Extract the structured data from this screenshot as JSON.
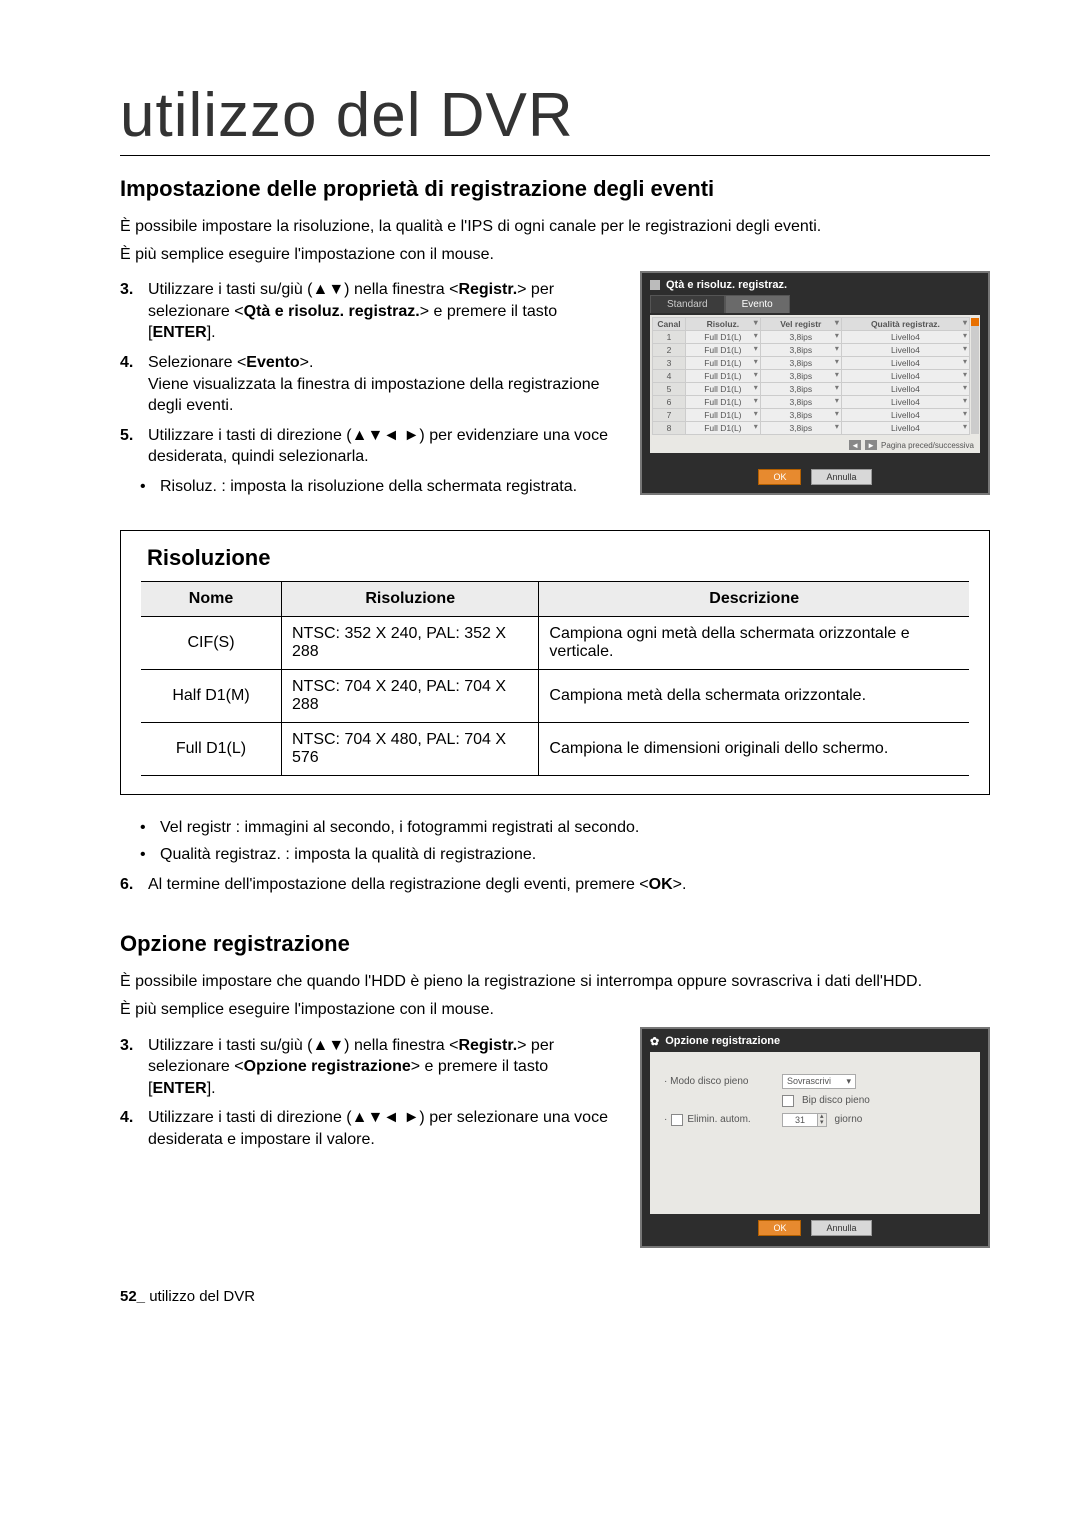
{
  "page_title": "utilizzo del DVR",
  "h2_1": "Impostazione delle proprietà di registrazione degli eventi",
  "intro_1": "È possibile impostare la risoluzione, la qualità e l'IPS di ogni canale per le registrazioni degli eventi.",
  "intro_2": "È più semplice eseguire l'impostazione con il mouse.",
  "step3_1": "Utilizzare i tasti su/giù (▲▼) nella finestra <",
  "step3_b1": "Registr.",
  "step3_2": "> per selezionare <",
  "step3_b2": "Qtà e risoluz. registraz.",
  "step3_3": "> e premere il tasto [",
  "step3_b3": "ENTER",
  "step3_4": "].",
  "step4_1": "Selezionare <",
  "step4_b1": "Evento",
  "step4_2": ">.",
  "step4_line2": "Viene visualizzata la finestra di impostazione della registrazione degli eventi.",
  "step5_1": "Utilizzare i tasti di direzione  (▲▼◄ ►)  per evidenziare una voce desiderata, quindi selezionarla.",
  "bullet_risoluz": "Risoluz. : imposta la risoluzione della schermata registrata.",
  "dvr1": {
    "title": "Qtà e risoluz. registraz.",
    "tab_standard": "Standard",
    "tab_evento": "Evento",
    "col_canal": "Canal",
    "col_risoluz": "Risoluz.",
    "col_vel": "Vel registr",
    "col_qual": "Qualità registraz.",
    "rows": [
      {
        "n": "1",
        "ris": "Full D1(L)",
        "vel": "3,8ips",
        "qual": "Livello4"
      },
      {
        "n": "2",
        "ris": "Full D1(L)",
        "vel": "3,8ips",
        "qual": "Livello4"
      },
      {
        "n": "3",
        "ris": "Full D1(L)",
        "vel": "3,8ips",
        "qual": "Livello4"
      },
      {
        "n": "4",
        "ris": "Full D1(L)",
        "vel": "3,8ips",
        "qual": "Livello4"
      },
      {
        "n": "5",
        "ris": "Full D1(L)",
        "vel": "3,8ips",
        "qual": "Livello4"
      },
      {
        "n": "6",
        "ris": "Full D1(L)",
        "vel": "3,8ips",
        "qual": "Livello4"
      },
      {
        "n": "7",
        "ris": "Full D1(L)",
        "vel": "3,8ips",
        "qual": "Livello4"
      },
      {
        "n": "8",
        "ris": "Full D1(L)",
        "vel": "3,8ips",
        "qual": "Livello4"
      }
    ],
    "pager": "Pagina preced/successiva",
    "ok": "OK",
    "cancel": "Annulla"
  },
  "res_box": {
    "title": "Risoluzione",
    "h_nome": "Nome",
    "h_ris": "Risoluzione",
    "h_desc": "Descrizione",
    "rows": [
      {
        "nome": "CIF(S)",
        "ris": "NTSC: 352 X 240, PAL: 352 X 288",
        "desc": "Campiona ogni metà della schermata orizzontale e verticale."
      },
      {
        "nome": "Half D1(M)",
        "ris": "NTSC: 704 X 240, PAL: 704 X 288",
        "desc": "Campiona metà della schermata orizzontale."
      },
      {
        "nome": "Full D1(L)",
        "ris": "NTSC: 704 X 480, PAL: 704 X 576",
        "desc": "Campiona le dimensioni originali dello schermo."
      }
    ]
  },
  "bullet_vel": "Vel registr : immagini al secondo, i fotogrammi registrati al secondo.",
  "bullet_qual": "Qualità registraz. : imposta la qualità di registrazione.",
  "step6_1": "Al termine dell'impostazione della registrazione degli eventi, premere <",
  "step6_b": "OK",
  "step6_2": ">.",
  "h2_2": "Opzione registrazione",
  "opt_intro_1": "È possibile impostare che quando l'HDD è pieno la registrazione si interrompa oppure sovrascriva i dati dell'HDD.",
  "opt_intro_2": "È più semplice eseguire l'impostazione con il mouse.",
  "opt_step3_1": "Utilizzare i tasti su/giù (▲▼) nella finestra <",
  "opt_step3_b1": "Registr.",
  "opt_step3_2": "> per selezionare <",
  "opt_step3_b2": "Opzione registrazione",
  "opt_step3_3": "> e premere il tasto [",
  "opt_step3_b3": "ENTER",
  "opt_step3_4": "].",
  "opt_step4": "Utilizzare i tasti di direzione (▲▼◄ ►) per selezionare una voce desiderata e impostare il valore.",
  "dvr2": {
    "title": "Opzione registrazione",
    "row1_label": "· Modo disco pieno",
    "row1_value": "Sovrascrivi",
    "row1_sub": "Bip disco pieno",
    "row2_label": "Elimin. autom.",
    "row2_value": "31",
    "row2_unit": "giorno",
    "ok": "OK",
    "cancel": "Annulla"
  },
  "footer_num": "52_",
  "footer_text": " utilizzo del DVR"
}
